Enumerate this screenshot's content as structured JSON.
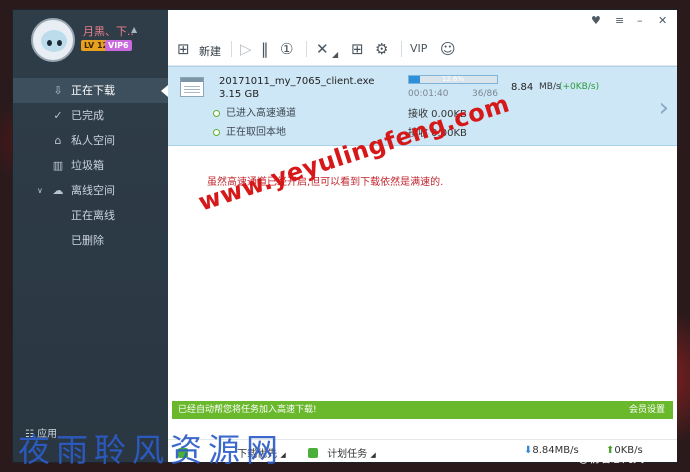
{
  "user": {
    "name": "月黑、下..",
    "level_badge": "LV 12",
    "vip_badge": "VIP6"
  },
  "sidebar": {
    "items": [
      {
        "label": "正在下载",
        "icon": "download-icon"
      },
      {
        "label": "已完成",
        "icon": "check-circle-icon"
      },
      {
        "label": "私人空间",
        "icon": "lock-icon"
      },
      {
        "label": "垃圾箱",
        "icon": "trash-icon"
      },
      {
        "label": "离线空间",
        "icon": "cloud-icon"
      },
      {
        "label": "正在离线",
        "icon": ""
      },
      {
        "label": "已删除",
        "icon": ""
      }
    ],
    "bottom_label": "应用"
  },
  "toolbar": {
    "new_label": "新建"
  },
  "task": {
    "filename": "20171011_my_7065_client.exe",
    "size": "3.15 GB",
    "status_1": "已进入高速通道",
    "status_2": "正在取回本地",
    "progress_percent": 12.6,
    "progress_label": "12.6%",
    "elapsed": "00:01:40",
    "blocks": "36/86",
    "speed": "8.84",
    "speed_unit": "MB/s",
    "speed_extra": "(+0KB/s)",
    "recv_1": "接收 0.00KB",
    "recv_2": "接收 0.00KB"
  },
  "note": "虽然高速通道已经开启,但可以看到下载依然是满速的.",
  "watermark": "www.yeyulingfeng.com",
  "notice": {
    "text": "已经自动帮您将任务加入高速下载!",
    "right_link": "会员设置"
  },
  "bottombar": {
    "download_priority": "下载优先",
    "scheduled_tasks": "计划任务",
    "down_speed": "8.84MB/s",
    "up_speed": "0KB/s"
  },
  "bottom_watermark": "夜雨聆风资源网",
  "weibo_credit": "@初若恕几天"
}
